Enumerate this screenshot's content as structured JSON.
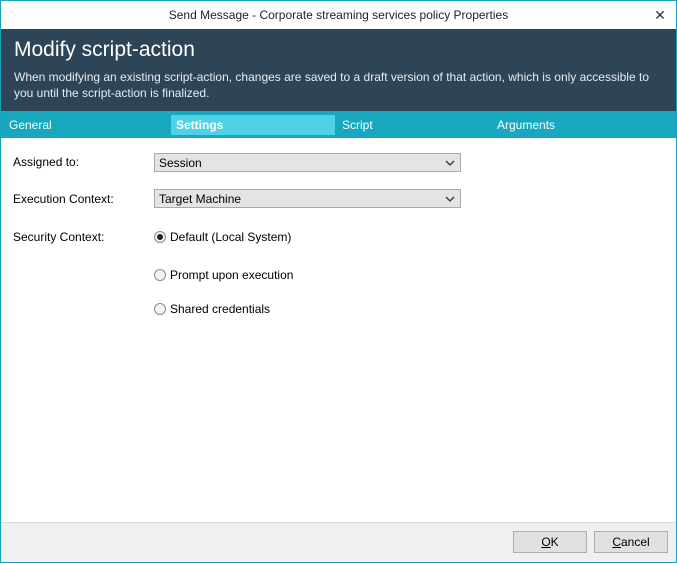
{
  "window": {
    "title": "Send Message - Corporate streaming services policy Properties",
    "close_glyph": "✕"
  },
  "header": {
    "title": "Modify script-action",
    "description": "When modifying an existing script-action, changes are saved to a draft version of that action, which is only accessible to you until the script-action is finalized."
  },
  "tabs": [
    {
      "label": "General",
      "active": false
    },
    {
      "label": "Settings",
      "active": true
    },
    {
      "label": "Script",
      "active": false
    },
    {
      "label": "Arguments",
      "active": false
    }
  ],
  "form": {
    "assigned_to": {
      "label": "Assigned to:",
      "value": "Session"
    },
    "execution_context": {
      "label": "Execution Context:",
      "value": "Target Machine"
    },
    "security_context": {
      "label": "Security Context:",
      "options": [
        {
          "label": "Default (Local System)",
          "selected": true
        },
        {
          "label": "Prompt upon execution",
          "selected": false
        },
        {
          "label": "Shared credentials",
          "selected": false
        }
      ]
    }
  },
  "footer": {
    "ok_accel": "O",
    "ok_rest": "K",
    "cancel_accel": "C",
    "cancel_rest": "ancel"
  },
  "colors": {
    "header_bg": "#2e4457",
    "tab_bar": "#17a8c0",
    "tab_active": "#4fd2e6",
    "border": "#17a2b8"
  }
}
